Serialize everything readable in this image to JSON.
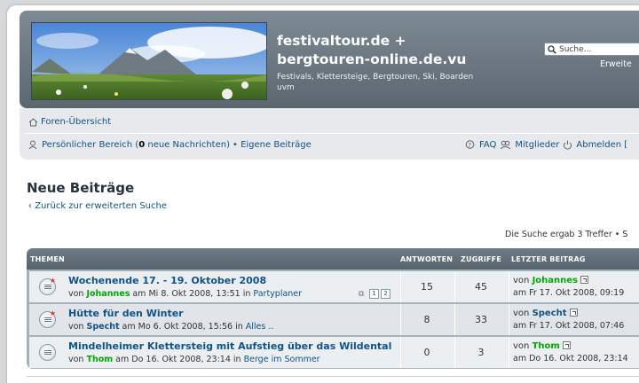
{
  "header": {
    "site_title": "festivaltour.de + bergtouren-online.de.vu",
    "site_description": "Festivals, Klettersteige, Bergtouren, Ski, Boarden uvm",
    "search_placeholder": "Suche…",
    "advanced_search": "Erweite"
  },
  "nav": {
    "forum_index": "Foren-Übersicht",
    "personal_area_pre": "Persönlicher Bereich (",
    "new_messages_count": "0",
    "personal_area_post": " neue Nachrichten)",
    "own_posts": "• Eigene Beiträge",
    "faq": "FAQ",
    "members": "Mitglieder",
    "logout": "Abmelden [",
    "accent_color": "#105289"
  },
  "page": {
    "title": "Neue Beiträge",
    "back_link": "Zurück zur erweiterten Suche",
    "result_count": "Die Suche ergab 3 Treffer • S"
  },
  "table": {
    "headers": {
      "topics": "THEMEN",
      "replies": "ANTWORTEN",
      "views": "ZUGRIFFE",
      "last_post": "LETZTER BEITRAG"
    },
    "rows": [
      {
        "title": "Wochenende 17. - 19. Oktober 2008",
        "by": "von ",
        "author": "Johannes",
        "author_color": "#00aa00",
        "date": " am Mi 8. Okt 2008, 13:51 in ",
        "forum": "Partyplaner",
        "pages": [
          "1",
          "2"
        ],
        "replies": "15",
        "views": "45",
        "last_by": "von ",
        "last_author": "Johannes",
        "last_author_color": "#00aa00",
        "last_date": "am Fr 17. Okt 2008, 09:19"
      },
      {
        "title": "Hütte für den Winter",
        "by": "von ",
        "author": "Specht",
        "author_color": "#105289",
        "date": " am Mo 6. Okt 2008, 15:56 in ",
        "forum": "Alles ..",
        "replies": "8",
        "views": "33",
        "last_by": "von ",
        "last_author": "Specht",
        "last_author_color": "#105289",
        "last_date": "am Fr 17. Okt 2008, 07:46"
      },
      {
        "title": "Mindelheimer Klettersteig mit Aufstieg über das Wildental",
        "by": "von ",
        "author": "Thom",
        "author_color": "#00aa00",
        "date": " am Do 16. Okt 2008, 23:14 in ",
        "forum": "Berge im Sommer",
        "replies": "0",
        "views": "3",
        "last_by": "von ",
        "last_author": "Thom",
        "last_author_color": "#00aa00",
        "last_date": "am Do 16. Okt 2008, 23:14"
      }
    ]
  }
}
